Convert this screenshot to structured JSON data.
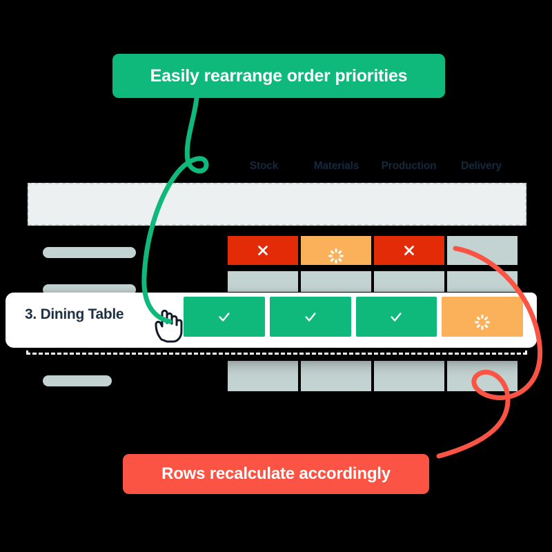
{
  "callouts": {
    "top": {
      "text": "Easily rearrange order priorities",
      "color": "#0FB97B"
    },
    "bottom": {
      "text": "Rows recalculate accordingly",
      "color": "#FB5444"
    }
  },
  "table": {
    "columns": [
      "Stock",
      "Materials",
      "Production",
      "Delivery"
    ],
    "status_row": [
      {
        "state": "bad",
        "icon": "x-icon"
      },
      {
        "state": "wait",
        "icon": "spinner-icon"
      },
      {
        "state": "bad",
        "icon": "x-icon"
      },
      {
        "state": "blank",
        "icon": "none"
      }
    ],
    "placeholder_row_a": [
      {
        "state": "blank"
      },
      {
        "state": "blank"
      },
      {
        "state": "blank"
      },
      {
        "state": "blank"
      }
    ],
    "placeholder_row_b": [
      {
        "state": "blank"
      },
      {
        "state": "blank"
      },
      {
        "state": "blank"
      },
      {
        "state": "blank"
      }
    ]
  },
  "dragged_row": {
    "label": "3. Dining Table",
    "cells": [
      {
        "state": "good",
        "icon": "check-icon"
      },
      {
        "state": "good",
        "icon": "check-icon"
      },
      {
        "state": "good",
        "icon": "check-icon"
      },
      {
        "state": "wait",
        "icon": "spinner-icon"
      }
    ]
  },
  "colors": {
    "green": "#0FB97B",
    "red": "#E32B07",
    "coral": "#FB5444",
    "orange": "#FBB05A",
    "grey_cell": "#C3D3D1",
    "band": "#ECF0F0",
    "text_dark": "#1D3044"
  }
}
